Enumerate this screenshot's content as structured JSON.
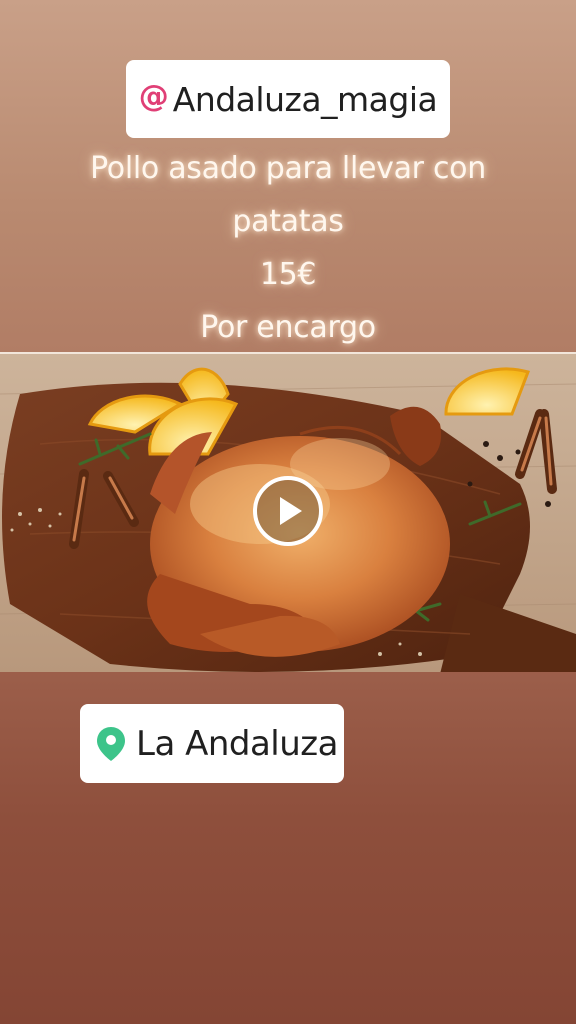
{
  "mention_sticker": {
    "icon": "at-icon",
    "text": "Andaluza_magia",
    "accent_color": "#e03f76"
  },
  "caption": {
    "lines": [
      "Pollo asado para llevar con",
      "patatas",
      "15€",
      "Por encargo"
    ]
  },
  "media": {
    "type": "video",
    "subject": "roast chicken on wooden board",
    "play_icon": "play-icon"
  },
  "location_sticker": {
    "icon": "map-pin-icon",
    "text": "La Andaluza",
    "pin_color": "#3dc48a"
  }
}
